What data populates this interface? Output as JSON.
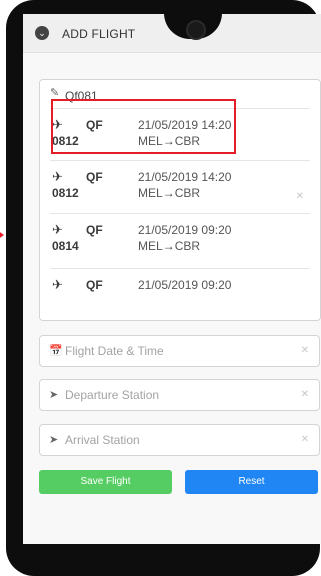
{
  "header": {
    "title": "ADD FLIGHT",
    "icon": "chevron-down-circle-icon"
  },
  "search": {
    "value": "Qf081"
  },
  "results": [
    {
      "airline": "QF",
      "flight_no": "0812",
      "date": "21/05/2019 14:20",
      "from": "MEL",
      "to": "CBR",
      "arrow": "→"
    },
    {
      "airline": "QF",
      "flight_no": "0812",
      "date": "21/05/2019 14:20",
      "from": "MEL",
      "to": "CBR",
      "arrow": "→"
    },
    {
      "airline": "QF",
      "flight_no": "0814",
      "date": "21/05/2019 09:20",
      "from": "MEL",
      "to": "CBR",
      "arrow": "→"
    },
    {
      "airline": "QF",
      "date": "21/05/2019 09:20"
    }
  ],
  "fields": {
    "date_time": {
      "placeholder": "Flight Date & Time",
      "icon": "calendar-icon"
    },
    "departure": {
      "placeholder": "Departure Station",
      "icon": "send-icon"
    },
    "arrival": {
      "placeholder": "Arrival Station",
      "icon": "send-icon"
    }
  },
  "buttons": {
    "save": "Save Flight",
    "reset": "Reset"
  },
  "colors": {
    "save": "#56cd63",
    "reset": "#1f86f3",
    "highlight": "#e41e26"
  }
}
